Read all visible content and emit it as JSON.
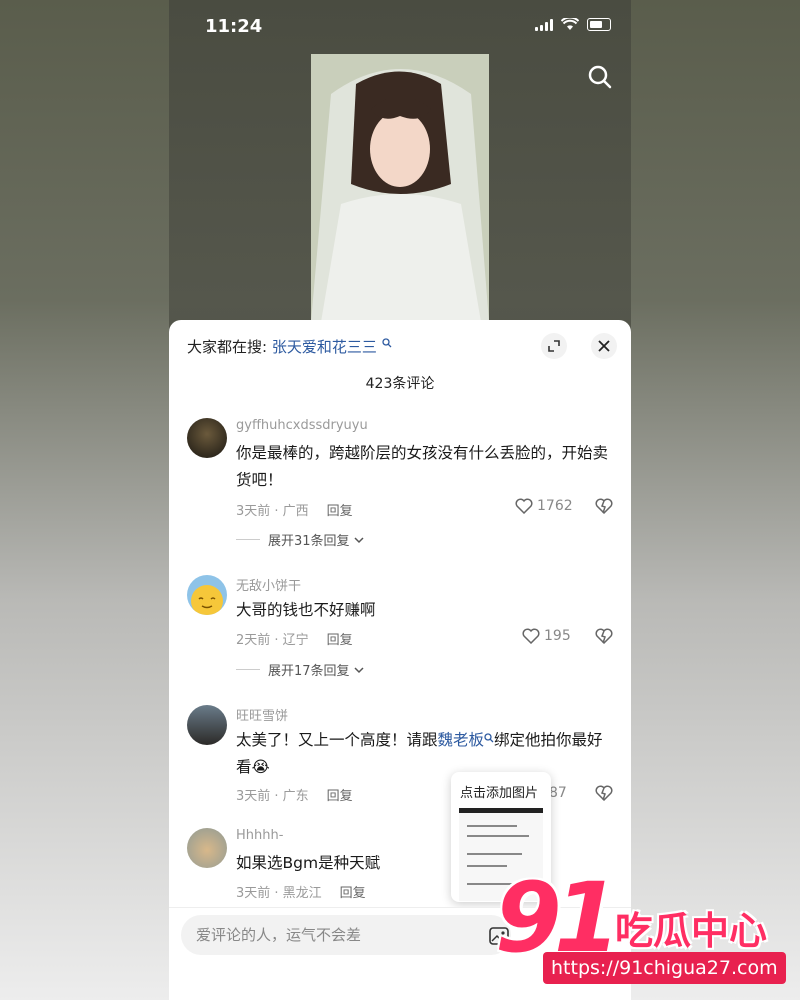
{
  "status_bar": {
    "time": "11:24"
  },
  "comments_panel": {
    "hot_search_prefix": "大家都在搜:",
    "hot_search_term": "张天爱和花三三",
    "comment_count": "423条评论",
    "comments": [
      {
        "username": "gyffhuhcxdssdryuyu",
        "text": "你是最棒的，跨越阶层的女孩没有什么丢脸的，开始卖货吧！",
        "meta": "3天前 · 广西",
        "reply_label": "回复",
        "likes": "1762",
        "expand_replies": "展开31条回复"
      },
      {
        "username": "无敌小饼干",
        "text": "大哥的钱也不好赚啊",
        "meta": "2天前 · 辽宁",
        "reply_label": "回复",
        "likes": "195",
        "expand_replies": "展开17条回复"
      },
      {
        "username": "旺旺雪饼",
        "text_before_link": "太美了！又上一个高度！请跟",
        "link_text": "魏老板",
        "text_after_link": "绑定他拍你最好看😭",
        "meta": "3天前 · 广东",
        "reply_label": "回复",
        "likes": "87"
      },
      {
        "username": "Hhhhh-",
        "text": "如果选Bgm是种天赋",
        "meta": "3天前 · 黑龙江",
        "reply_label": "回复"
      }
    ],
    "add_image_popup": "点击添加图片",
    "input_placeholder": "爱评论的人，运气不会差"
  },
  "watermark": {
    "number": "91",
    "text": "吃瓜中心",
    "url": "https://91chigua27.com"
  },
  "colors": {
    "link": "#2d5aa0",
    "watermark": "#ff2e63"
  }
}
